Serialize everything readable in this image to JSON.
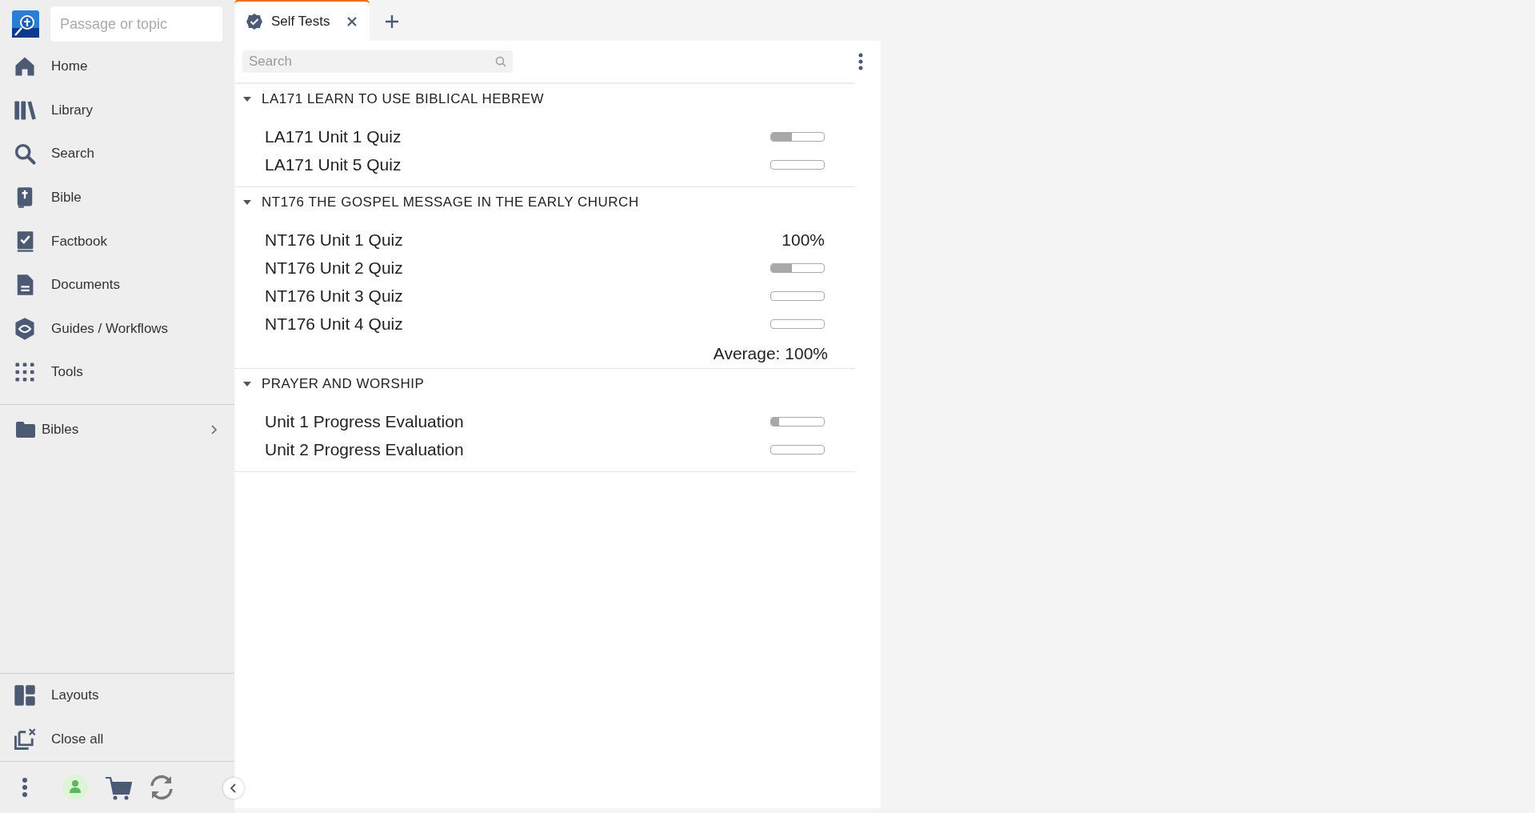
{
  "sidebar": {
    "search": {
      "placeholder": "Passage or topic"
    },
    "items": [
      {
        "label": "Home"
      },
      {
        "label": "Library"
      },
      {
        "label": "Search"
      },
      {
        "label": "Bible"
      },
      {
        "label": "Factbook"
      },
      {
        "label": "Documents"
      },
      {
        "label": "Guides / Workflows"
      },
      {
        "label": "Tools"
      }
    ],
    "folder": {
      "label": "Bibles"
    },
    "bottom_items": [
      {
        "label": "Layouts"
      },
      {
        "label": "Close all"
      }
    ]
  },
  "tabs": [
    {
      "label": "Self Tests",
      "selected": true
    }
  ],
  "panel": {
    "search": {
      "placeholder": "Search"
    },
    "sections": [
      {
        "title": "LA171 LEARN TO USE BIBLICAL HEBREW",
        "expanded": true,
        "items": [
          {
            "label": "LA171 Unit 1 Quiz",
            "kind": "progress",
            "level": 0.4
          },
          {
            "label": "LA171 Unit 5 Quiz",
            "kind": "progress",
            "level": 0
          }
        ]
      },
      {
        "title": "NT176 THE GOSPEL MESSAGE IN THE EARLY CHURCH",
        "expanded": true,
        "items": [
          {
            "label": "NT176 Unit 1 Quiz",
            "kind": "score",
            "score": "100%"
          },
          {
            "label": "NT176 Unit 2 Quiz",
            "kind": "progress",
            "level": 0.4
          },
          {
            "label": "NT176 Unit 3 Quiz",
            "kind": "progress",
            "level": 0
          },
          {
            "label": "NT176 Unit 4 Quiz",
            "kind": "progress",
            "level": 0
          }
        ],
        "average": "Average:  100%"
      },
      {
        "title": "PRAYER AND WORSHIP",
        "expanded": true,
        "items": [
          {
            "label": "Unit 1  Progress Evaluation",
            "kind": "progress",
            "level": 0.15
          },
          {
            "label": "Unit 2  Progress Evaluation",
            "kind": "progress",
            "level": 0
          }
        ]
      }
    ]
  }
}
